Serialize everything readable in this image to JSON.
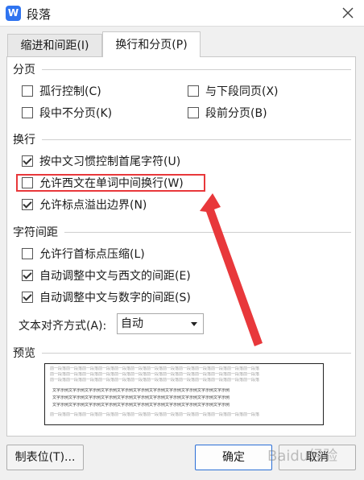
{
  "window": {
    "title": "段落",
    "app_logo_letter": "W"
  },
  "tabs": [
    {
      "label": "缩进和间距(I)"
    },
    {
      "label": "换行和分页(P)"
    }
  ],
  "sections": {
    "pagination": {
      "title": "分页"
    },
    "line_break": {
      "title": "换行"
    },
    "char_spacing": {
      "title": "字符间距"
    },
    "preview": {
      "title": "预览"
    }
  },
  "checkboxes": {
    "widow_control": {
      "label": "孤行控制(C)",
      "checked": false
    },
    "keep_with_next": {
      "label": "与下段同页(X)",
      "checked": false
    },
    "keep_lines_together": {
      "label": "段中不分页(K)",
      "checked": false
    },
    "page_break_before": {
      "label": "段前分页(B)",
      "checked": false
    },
    "chinese_line_break_rules": {
      "label": "按中文习惯控制首尾字符(U)",
      "checked": true
    },
    "allow_latin_word_break": {
      "label": "允许西文在单词中间换行(W)",
      "checked": false
    },
    "allow_punct_overflow": {
      "label": "允许标点溢出边界(N)",
      "checked": true
    },
    "compress_leading_punct": {
      "label": "允许行首标点压缩(L)",
      "checked": false
    },
    "auto_space_cn_latin": {
      "label": "自动调整中文与西文的间距(E)",
      "checked": true
    },
    "auto_space_cn_digits": {
      "label": "自动调整中文与数字的间距(S)",
      "checked": true
    }
  },
  "text_alignment": {
    "label": "文本对齐方式(A):",
    "value": "自动"
  },
  "preview_text": {
    "gray_line": "前一段落前一段落前一段落前一段落前一段落前一段落前一段落前一段落前一段落前一段落前一段落前一段落前一段落",
    "sample_line": "文字示例文字示例文字示例文字示例文字示例文字示例文字示例文字示例文字示例文字示例文字示例"
  },
  "buttons": {
    "tabs": "制表位(T)...",
    "ok": "确定",
    "cancel": "取消"
  },
  "watermark": "Baidu经验",
  "colors": {
    "highlight": "#e8383b",
    "accent": "#2f74f0",
    "arrow": "#e8383b"
  }
}
